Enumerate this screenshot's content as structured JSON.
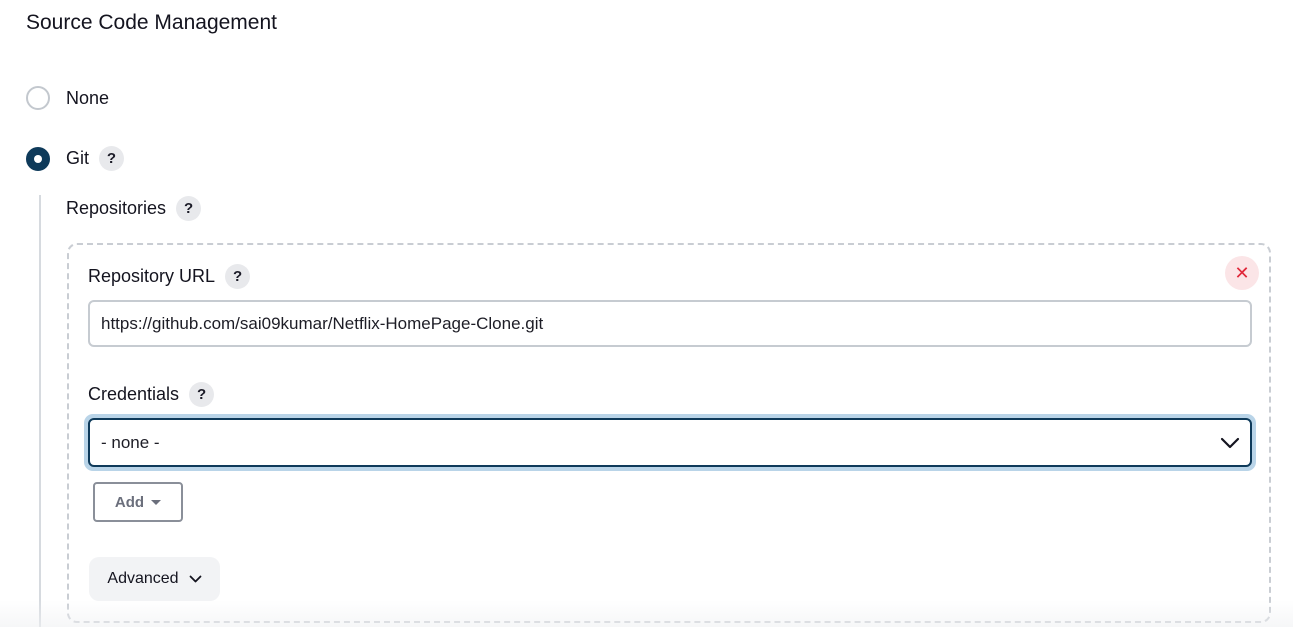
{
  "section": {
    "title": "Source Code Management"
  },
  "scm_options": [
    {
      "label": "None",
      "selected": false
    },
    {
      "label": "Git",
      "selected": true,
      "help": "?"
    }
  ],
  "git": {
    "repositories_label": "Repositories",
    "help": "?",
    "repository": {
      "url_label": "Repository URL",
      "url_value": "https://github.com/sai09kumar/Netflix-HomePage-Clone.git",
      "credentials_label": "Credentials",
      "credentials_selected": "- none -",
      "add_label": "Add",
      "advanced_label": "Advanced",
      "remove_icon": "close-icon"
    }
  },
  "colors": {
    "accent": "#0e3a5a",
    "focus_ring": "#b9d4e8",
    "remove_bg": "#fbe5e7",
    "remove_fg": "#e0283a"
  }
}
